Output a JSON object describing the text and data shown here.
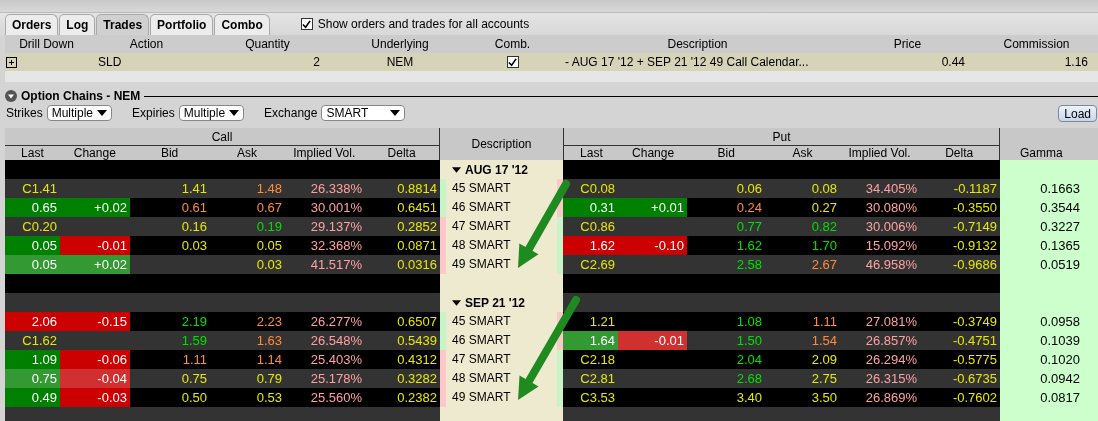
{
  "tabs": [
    {
      "label": "Orders",
      "selected": false
    },
    {
      "label": "Log",
      "selected": false
    },
    {
      "label": "Trades",
      "selected": true
    },
    {
      "label": "Portfolio",
      "selected": false
    },
    {
      "label": "Combo",
      "selected": false
    }
  ],
  "show_all_accounts": {
    "label": "Show orders and trades for all accounts",
    "checked": true
  },
  "trades": {
    "columns": [
      "Drill Down",
      "Action",
      "Quantity",
      "Underlying",
      "Comb.",
      "Description",
      "Price",
      "Commission"
    ],
    "rows": [
      {
        "action": "SLD",
        "quantity": "2",
        "underlying": "NEM",
        "combined": true,
        "description": "- AUG 17 '12 + SEP 21 '12 49 Call Calendar...",
        "price": "0.44",
        "commission": "1.16"
      }
    ]
  },
  "chain": {
    "title": "Option Chains - NEM",
    "filters": [
      {
        "label": "Strikes",
        "value": "Multiple"
      },
      {
        "label": "Expiries",
        "value": "Multiple"
      },
      {
        "label": "Exchange",
        "value": "SMART"
      }
    ],
    "load_button": "Load",
    "call_header": "Call",
    "put_header": "Put",
    "description_header": "Description",
    "gamma_header": "Gamma",
    "call_columns": [
      "Last",
      "Change",
      "Bid",
      "Ask",
      "Implied Vol.",
      "Delta"
    ],
    "put_columns": [
      "Last",
      "Change",
      "Bid",
      "Ask",
      "Implied Vol.",
      "Delta"
    ],
    "expiries": [
      {
        "label": "AUG 17 '12",
        "strikes": [
          {
            "description": "45 SMART",
            "call_in_the_money": true,
            "gamma": "0.1663",
            "call": {
              "last": {
                "text": "C1.41",
                "highlighted": false
              },
              "bid": {
                "text": "1.41",
                "changed": false
              },
              "ask": {
                "text": "1.48",
                "changed": true,
                "rising": false
              },
              "implied_vol": {
                "text": "26.338%"
              },
              "delta": {
                "text": "0.8814"
              }
            },
            "put": {
              "last": {
                "text": "C0.08",
                "highlighted": false
              },
              "bid": {
                "text": "0.06",
                "changed": false
              },
              "ask": {
                "text": "0.08",
                "changed": false
              },
              "implied_vol": {
                "text": "34.405%"
              },
              "delta": {
                "text": "-0.1187"
              }
            }
          },
          {
            "description": "46 SMART",
            "call_in_the_money": true,
            "gamma": "0.3544",
            "call": {
              "last": {
                "text": "0.65",
                "highlighted": true,
                "rising": true,
                "faded": false
              },
              "change": {
                "text": "+0.02",
                "highlighted": true,
                "rising": true,
                "faded": false
              },
              "bid": {
                "text": "0.61",
                "changed": true,
                "rising": false
              },
              "ask": {
                "text": "0.67",
                "changed": true,
                "rising": false
              },
              "implied_vol": {
                "text": "30.001%"
              },
              "delta": {
                "text": "0.6451"
              }
            },
            "put": {
              "last": {
                "text": "0.31",
                "highlighted": true,
                "rising": true,
                "faded": false
              },
              "change": {
                "text": "+0.01",
                "highlighted": true,
                "rising": true,
                "faded": false
              },
              "bid": {
                "text": "0.24",
                "changed": true,
                "rising": false
              },
              "ask": {
                "text": "0.27",
                "changed": false
              },
              "implied_vol": {
                "text": "30.080%"
              },
              "delta": {
                "text": "-0.3550"
              }
            }
          },
          {
            "description": "47 SMART",
            "call_in_the_money": false,
            "gamma": "0.3227",
            "call": {
              "last": {
                "text": "C0.20",
                "highlighted": false
              },
              "bid": {
                "text": "0.16",
                "changed": false
              },
              "ask": {
                "text": "0.19",
                "changed": true,
                "rising": true
              },
              "implied_vol": {
                "text": "29.137%"
              },
              "delta": {
                "text": "0.2852"
              }
            },
            "put": {
              "last": {
                "text": "C0.86",
                "highlighted": false
              },
              "bid": {
                "text": "0.77",
                "changed": true,
                "rising": true
              },
              "ask": {
                "text": "0.82",
                "changed": true,
                "rising": true
              },
              "implied_vol": {
                "text": "30.006%"
              },
              "delta": {
                "text": "-0.7149"
              }
            }
          },
          {
            "description": "48 SMART",
            "call_in_the_money": false,
            "gamma": "0.1365",
            "call": {
              "last": {
                "text": "0.05",
                "highlighted": true,
                "rising": true,
                "faded": false
              },
              "change": {
                "text": "-0.01",
                "highlighted": true,
                "rising": false,
                "faded": false
              },
              "bid": {
                "text": "0.03",
                "changed": false
              },
              "ask": {
                "text": "0.05",
                "changed": false
              },
              "implied_vol": {
                "text": "32.368%"
              },
              "delta": {
                "text": "0.0871"
              }
            },
            "put": {
              "last": {
                "text": "1.62",
                "highlighted": true,
                "rising": false,
                "faded": false
              },
              "change": {
                "text": "-0.10",
                "highlighted": true,
                "rising": false,
                "faded": false
              },
              "bid": {
                "text": "1.62",
                "changed": true,
                "rising": true
              },
              "ask": {
                "text": "1.70",
                "changed": true,
                "rising": true
              },
              "implied_vol": {
                "text": "15.092%"
              },
              "delta": {
                "text": "-0.9132"
              }
            }
          },
          {
            "description": "49 SMART",
            "call_in_the_money": false,
            "gamma": "0.0519",
            "call": {
              "last": {
                "text": "0.05",
                "highlighted": true,
                "rising": true,
                "faded": true
              },
              "change": {
                "text": "+0.02",
                "highlighted": true,
                "rising": true,
                "faded": true
              },
              "ask": {
                "text": "0.03",
                "changed": false
              },
              "implied_vol": {
                "text": "41.517%"
              },
              "delta": {
                "text": "0.0316"
              }
            },
            "put": {
              "last": {
                "text": "C2.69",
                "highlighted": false
              },
              "bid": {
                "text": "2.58",
                "changed": true,
                "rising": true
              },
              "ask": {
                "text": "2.67",
                "changed": true,
                "rising": false
              },
              "implied_vol": {
                "text": "46.958%"
              },
              "delta": {
                "text": "-0.9686"
              }
            }
          }
        ]
      },
      {
        "label": "SEP 21 '12",
        "strikes": [
          {
            "description": "45 SMART",
            "call_in_the_money": true,
            "gamma": "0.0958",
            "call": {
              "last": {
                "text": "2.06",
                "highlighted": true,
                "rising": false,
                "faded": false
              },
              "change": {
                "text": "-0.15",
                "highlighted": true,
                "rising": false,
                "faded": false
              },
              "bid": {
                "text": "2.19",
                "changed": true,
                "rising": true
              },
              "ask": {
                "text": "2.23",
                "changed": true,
                "rising": false
              },
              "implied_vol": {
                "text": "26.277%"
              },
              "delta": {
                "text": "0.6507"
              }
            },
            "put": {
              "last": {
                "text": "1.21",
                "highlighted": false
              },
              "bid": {
                "text": "1.08",
                "changed": true,
                "rising": true
              },
              "ask": {
                "text": "1.11",
                "changed": true,
                "rising": false
              },
              "implied_vol": {
                "text": "27.081%"
              },
              "delta": {
                "text": "-0.3749"
              }
            }
          },
          {
            "description": "46 SMART",
            "call_in_the_money": true,
            "gamma": "0.1039",
            "call": {
              "last": {
                "text": "C1.62",
                "highlighted": false
              },
              "bid": {
                "text": "1.59",
                "changed": true,
                "rising": true
              },
              "ask": {
                "text": "1.63",
                "changed": true,
                "rising": false
              },
              "implied_vol": {
                "text": "26.548%"
              },
              "delta": {
                "text": "0.5439"
              }
            },
            "put": {
              "last": {
                "text": "1.64",
                "highlighted": true,
                "rising": true,
                "faded": true
              },
              "change": {
                "text": "-0.01",
                "highlighted": true,
                "rising": false,
                "faded": true
              },
              "bid": {
                "text": "1.50",
                "changed": true,
                "rising": true
              },
              "ask": {
                "text": "1.54",
                "changed": true,
                "rising": false
              },
              "implied_vol": {
                "text": "26.857%"
              },
              "delta": {
                "text": "-0.4751"
              }
            }
          },
          {
            "description": "47 SMART",
            "call_in_the_money": false,
            "gamma": "0.1020",
            "call": {
              "last": {
                "text": "1.09",
                "highlighted": true,
                "rising": true,
                "faded": false
              },
              "change": {
                "text": "-0.06",
                "highlighted": true,
                "rising": false,
                "faded": false
              },
              "bid": {
                "text": "1.11",
                "changed": true,
                "rising": false
              },
              "ask": {
                "text": "1.14",
                "changed": true,
                "rising": false
              },
              "implied_vol": {
                "text": "25.403%"
              },
              "delta": {
                "text": "0.4312"
              }
            },
            "put": {
              "last": {
                "text": "C2.18",
                "highlighted": false
              },
              "bid": {
                "text": "2.04",
                "changed": true,
                "rising": true
              },
              "ask": {
                "text": "2.09",
                "changed": false
              },
              "implied_vol": {
                "text": "26.294%"
              },
              "delta": {
                "text": "-0.5775"
              }
            }
          },
          {
            "description": "48 SMART",
            "call_in_the_money": false,
            "gamma": "0.0942",
            "call": {
              "last": {
                "text": "0.75",
                "highlighted": true,
                "rising": true,
                "faded": true
              },
              "change": {
                "text": "-0.04",
                "highlighted": true,
                "rising": false,
                "faded": true
              },
              "bid": {
                "text": "0.75",
                "changed": false
              },
              "ask": {
                "text": "0.79",
                "changed": false
              },
              "implied_vol": {
                "text": "25.178%"
              },
              "delta": {
                "text": "0.3282"
              }
            },
            "put": {
              "last": {
                "text": "C2.81",
                "highlighted": false
              },
              "bid": {
                "text": "2.68",
                "changed": true,
                "rising": true
              },
              "ask": {
                "text": "2.75",
                "changed": false
              },
              "implied_vol": {
                "text": "26.315%"
              },
              "delta": {
                "text": "-0.6735"
              }
            }
          },
          {
            "description": "49 SMART",
            "call_in_the_money": false,
            "gamma": "0.0817",
            "call": {
              "last": {
                "text": "0.49",
                "highlighted": true,
                "rising": true,
                "faded": false
              },
              "change": {
                "text": "-0.03",
                "highlighted": true,
                "rising": false,
                "faded": false
              },
              "bid": {
                "text": "0.50",
                "changed": false
              },
              "ask": {
                "text": "0.53",
                "changed": false
              },
              "implied_vol": {
                "text": "25.560%"
              },
              "delta": {
                "text": "0.2382"
              }
            },
            "put": {
              "last": {
                "text": "C3.53",
                "highlighted": false
              },
              "bid": {
                "text": "3.40",
                "changed": false
              },
              "ask": {
                "text": "3.50",
                "changed": false
              },
              "implied_vol": {
                "text": "26.869%"
              },
              "delta": {
                "text": "-0.7602"
              }
            }
          }
        ]
      }
    ]
  }
}
